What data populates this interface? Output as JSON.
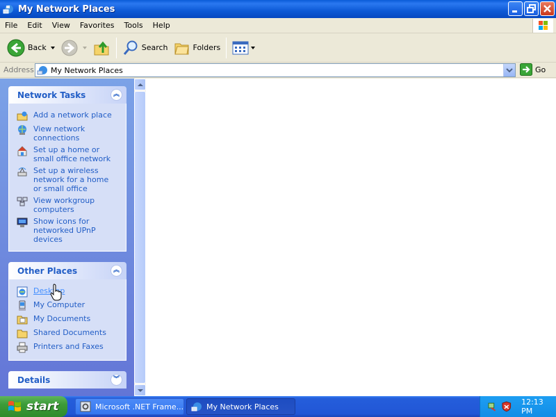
{
  "window": {
    "title": "My Network Places"
  },
  "menu": [
    "File",
    "Edit",
    "View",
    "Favorites",
    "Tools",
    "Help"
  ],
  "toolbar": {
    "back_label": "Back",
    "search_label": "Search",
    "folders_label": "Folders"
  },
  "address": {
    "label": "Address",
    "value": "My Network Places",
    "go_label": "Go"
  },
  "network_tasks": {
    "title": "Network Tasks",
    "items": [
      {
        "label": "Add a network place",
        "icon": "add-network-place-icon"
      },
      {
        "label": "View network connections",
        "icon": "network-connections-icon"
      },
      {
        "label": "Set up a home or small office network",
        "icon": "home-network-icon"
      },
      {
        "label": "Set up a wireless network for a home or small office",
        "icon": "wireless-network-icon"
      },
      {
        "label": "View workgroup computers",
        "icon": "workgroup-computers-icon"
      },
      {
        "label": "Show icons for networked UPnP devices",
        "icon": "upnp-devices-icon"
      }
    ]
  },
  "other_places": {
    "title": "Other Places",
    "items": [
      {
        "label": "Desktop",
        "icon": "desktop-icon"
      },
      {
        "label": "My Computer",
        "icon": "my-computer-icon"
      },
      {
        "label": "My Documents",
        "icon": "my-documents-icon"
      },
      {
        "label": "Shared Documents",
        "icon": "shared-documents-icon"
      },
      {
        "label": "Printers and Faxes",
        "icon": "printers-faxes-icon"
      }
    ]
  },
  "details": {
    "title": "Details"
  },
  "taskbar": {
    "start_label": "start",
    "buttons": [
      {
        "label": "Microsoft .NET Frame...",
        "active": false
      },
      {
        "label": "My Network Places",
        "active": true
      }
    ],
    "clock": "12:13 PM"
  },
  "colors": {
    "title_blue": "#0a5bd8",
    "task_link": "#215dc6",
    "taskpane_top": "#7ba2e7",
    "start_green": "#3c9b38"
  }
}
